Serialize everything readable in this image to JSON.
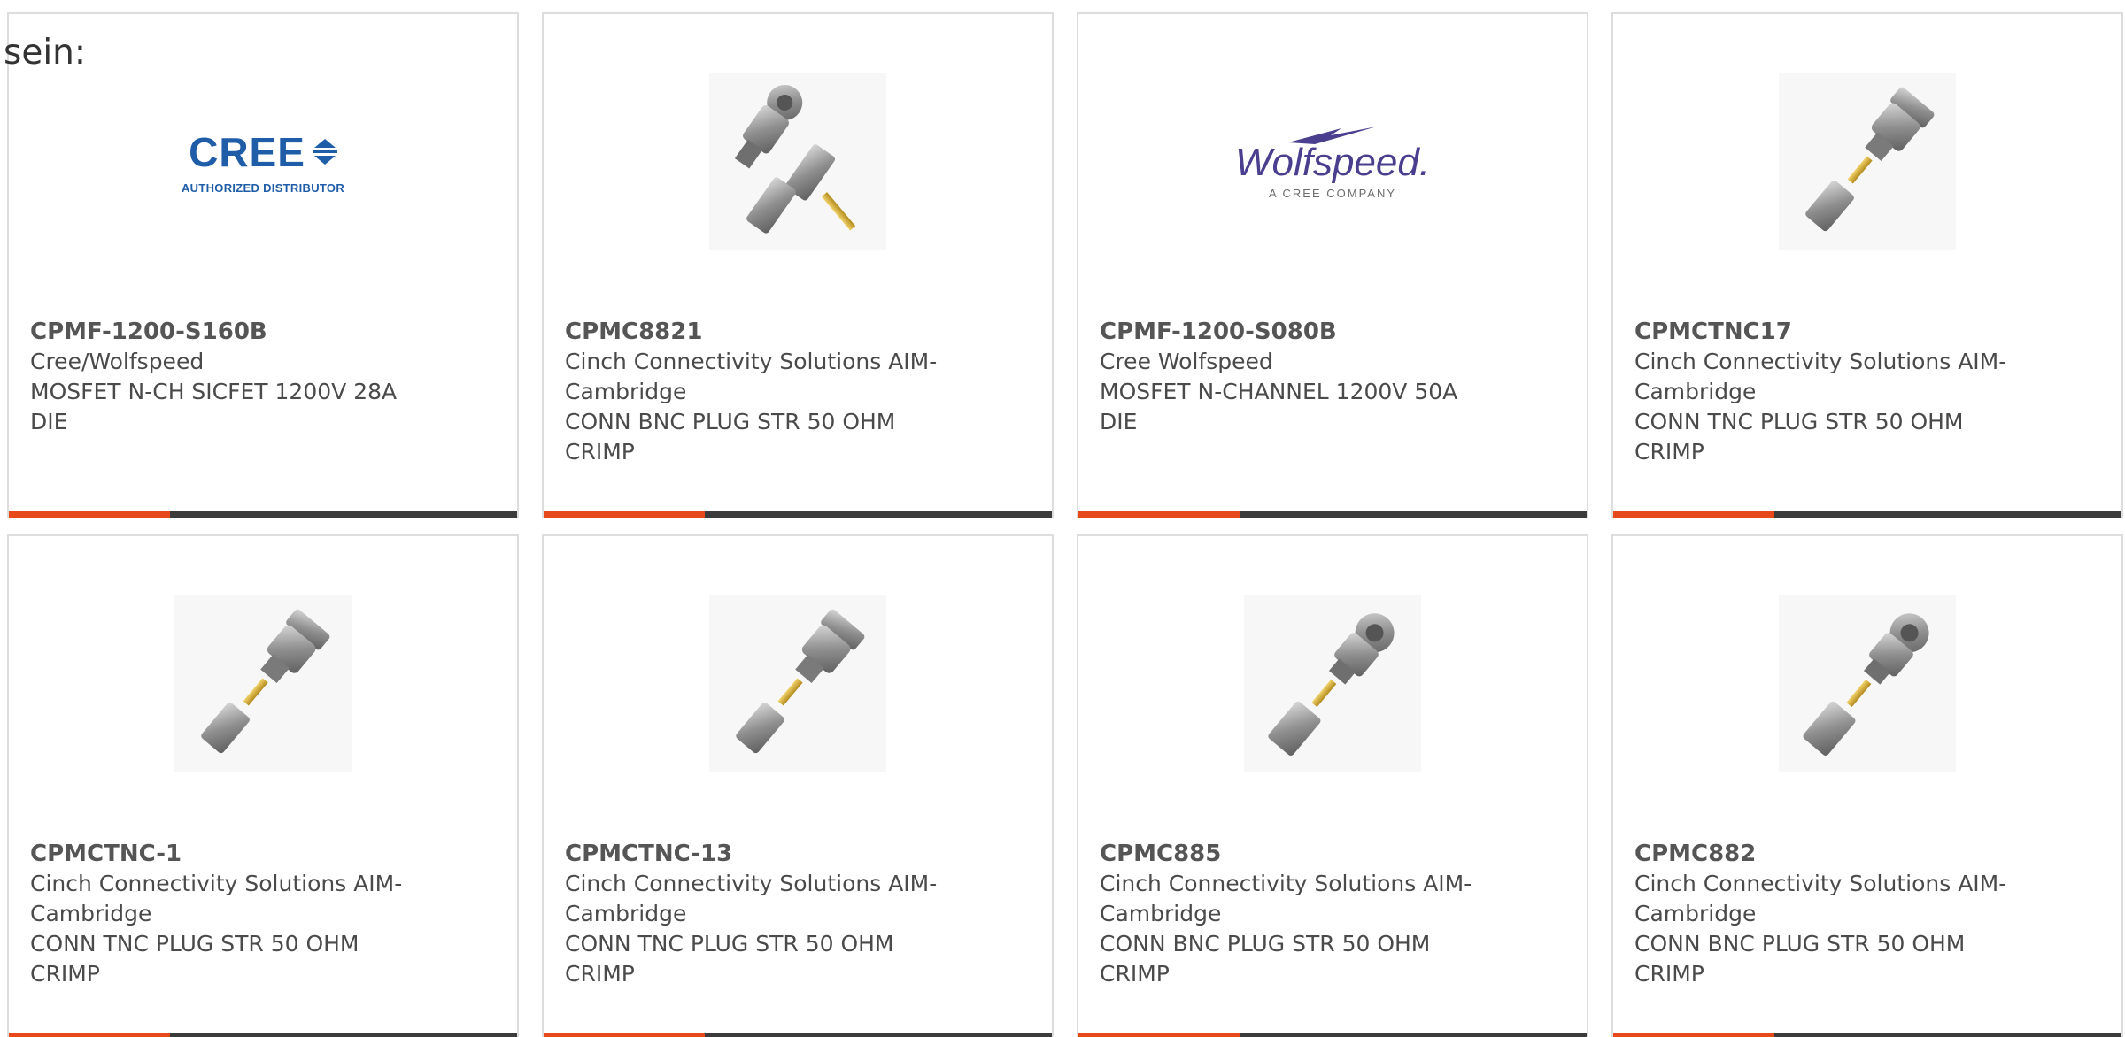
{
  "intro_text": "sein:",
  "colors": {
    "accent": "#e8491a",
    "bar": "#3b3b3b",
    "border": "#dddddd"
  },
  "products": [
    {
      "part_number": "CPMF-1200-S160B",
      "manufacturer": "Cree/Wolfspeed",
      "description": "MOSFET N-CH SICFET 1200V 28A DIE",
      "image": "cree-logo",
      "logo_name": "CREE",
      "logo_tagline": "AUTHORIZED DISTRIBUTOR"
    },
    {
      "part_number": "CPMC8821",
      "manufacturer": "Cinch Connectivity Solutions AIM-Cambridge",
      "description": "CONN BNC PLUG STR 50 OHM CRIMP",
      "image": "bnc-connector-kit"
    },
    {
      "part_number": "CPMF-1200-S080B",
      "manufacturer": "Cree Wolfspeed",
      "description": "MOSFET N-CHANNEL 1200V 50A DIE",
      "image": "wolfspeed-logo",
      "logo_name": "Wolfspeed.",
      "logo_tagline": "A CREE COMPANY"
    },
    {
      "part_number": "CPMCTNC17",
      "manufacturer": "Cinch Connectivity Solutions AIM-Cambridge",
      "description": "CONN TNC PLUG STR 50 OHM CRIMP",
      "image": "tnc-connector"
    },
    {
      "part_number": "CPMCTNC-1",
      "manufacturer": "Cinch Connectivity Solutions AIM-Cambridge",
      "description": "CONN TNC PLUG STR 50 OHM CRIMP",
      "image": "tnc-connector"
    },
    {
      "part_number": "CPMCTNC-13",
      "manufacturer": "Cinch Connectivity Solutions AIM-Cambridge",
      "description": "CONN TNC PLUG STR 50 OHM CRIMP",
      "image": "tnc-connector"
    },
    {
      "part_number": "CPMC885",
      "manufacturer": "Cinch Connectivity Solutions AIM-Cambridge",
      "description": "CONN BNC PLUG STR 50 OHM CRIMP",
      "image": "bnc-connector"
    },
    {
      "part_number": "CPMC882",
      "manufacturer": "Cinch Connectivity Solutions AIM-Cambridge",
      "description": "CONN BNC PLUG STR 50 OHM CRIMP",
      "image": "bnc-connector"
    }
  ]
}
